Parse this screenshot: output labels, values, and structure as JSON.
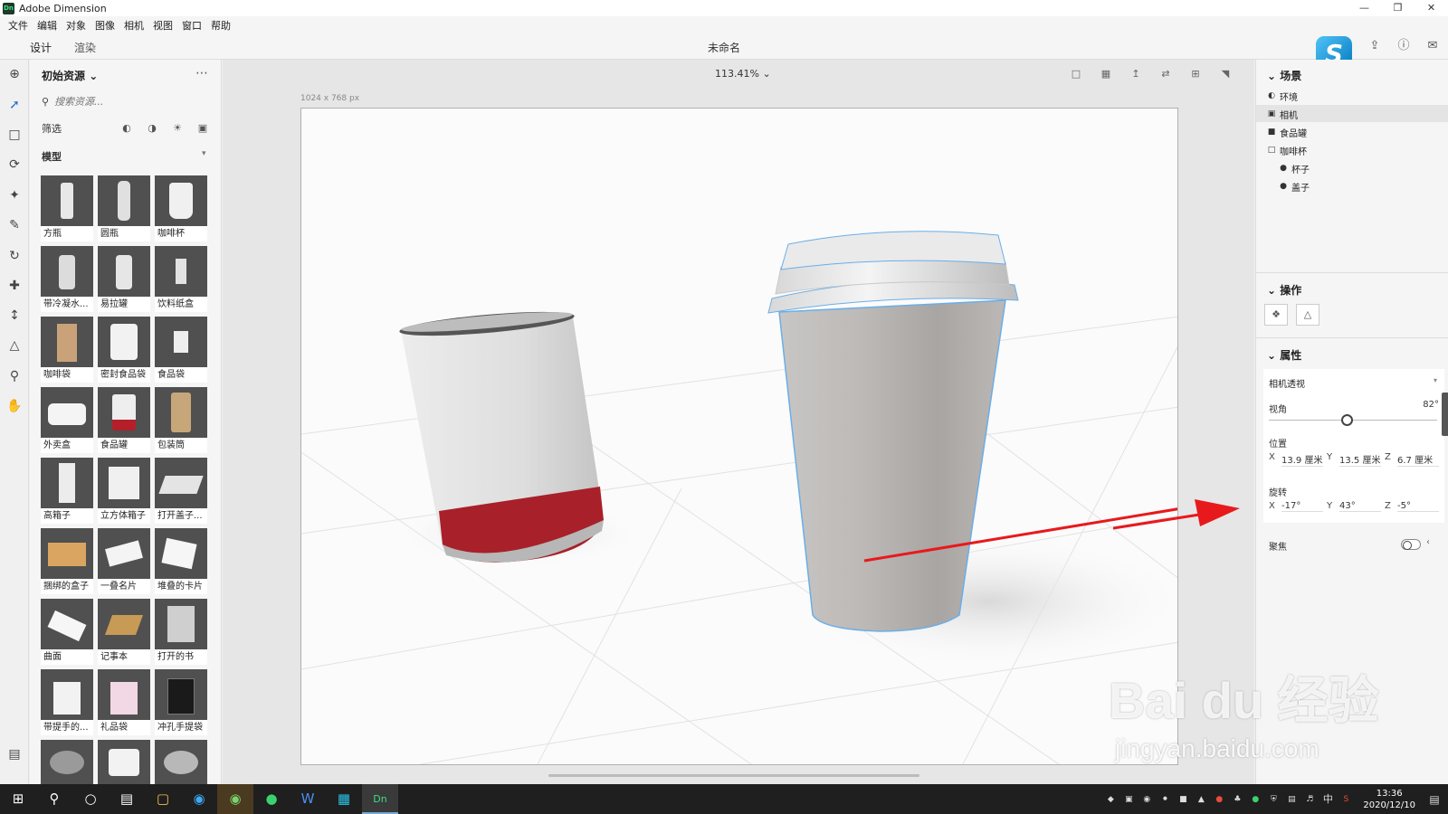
{
  "window": {
    "title": "Adobe Dimension",
    "app_badge": "Dn"
  },
  "menu": [
    "文件",
    "编辑",
    "对象",
    "图像",
    "相机",
    "视图",
    "窗口",
    "帮助"
  ],
  "tabs": {
    "design": "设计",
    "render": "渲染"
  },
  "document": {
    "title": "未命名"
  },
  "assets": {
    "header": "初始资源",
    "search_placeholder": "搜索资源...",
    "filter_label": "筛选",
    "section": "模型",
    "items": [
      {
        "label": "方瓶"
      },
      {
        "label": "圆瓶"
      },
      {
        "label": "咖啡杯"
      },
      {
        "label": "带冷凝水..."
      },
      {
        "label": "易拉罐"
      },
      {
        "label": "饮料纸盒"
      },
      {
        "label": "咖啡袋"
      },
      {
        "label": "密封食品袋"
      },
      {
        "label": "食品袋"
      },
      {
        "label": "外卖盒"
      },
      {
        "label": "食品罐"
      },
      {
        "label": "包装筒"
      },
      {
        "label": "高箱子"
      },
      {
        "label": "立方体箱子"
      },
      {
        "label": "打开盖子..."
      },
      {
        "label": "捆绑的盒子"
      },
      {
        "label": "一叠名片"
      },
      {
        "label": "堆叠的卡片"
      },
      {
        "label": "曲面"
      },
      {
        "label": "记事本"
      },
      {
        "label": "打开的书"
      },
      {
        "label": "带提手的..."
      },
      {
        "label": "礼品袋"
      },
      {
        "label": "冲孔手提袋"
      },
      {
        "label": ""
      },
      {
        "label": ""
      },
      {
        "label": ""
      }
    ]
  },
  "viewport": {
    "zoom": "113.41%",
    "canvas_size": "1024 x 768 px"
  },
  "scene": {
    "header": "场景",
    "items": [
      {
        "label": "环境",
        "icon": "environment-icon"
      },
      {
        "label": "相机",
        "icon": "camera-icon"
      },
      {
        "label": "食品罐",
        "icon": "folder-icon"
      },
      {
        "label": "咖啡杯",
        "icon": "folder-open-icon"
      },
      {
        "label": "杯子",
        "icon": "model-icon"
      },
      {
        "label": "盖子",
        "icon": "model-icon"
      }
    ]
  },
  "actions": {
    "header": "操作"
  },
  "properties": {
    "header": "属性",
    "camera_mode": "相机透视",
    "fov_label": "视角",
    "fov_value": "82°",
    "fov_level": 0.46,
    "position_label": "位置",
    "position": {
      "x": "13.9 厘米",
      "y": "13.5 厘米",
      "z": "6.7 厘米"
    },
    "rotation_label": "旋转",
    "rotation": {
      "x": "-17°",
      "y": "43°",
      "z": "-5°"
    },
    "focus_label": "聚焦"
  },
  "taskbar": {
    "time": "13:36",
    "date": "2020/12/10",
    "ime": "中"
  },
  "watermark": {
    "brand": "Bai du 经验",
    "url": "jingyan.baidu.com"
  },
  "colors": {
    "arrow": "#e8191c",
    "cup_outline": "#6aaee8",
    "can_band": "#a8202a"
  }
}
